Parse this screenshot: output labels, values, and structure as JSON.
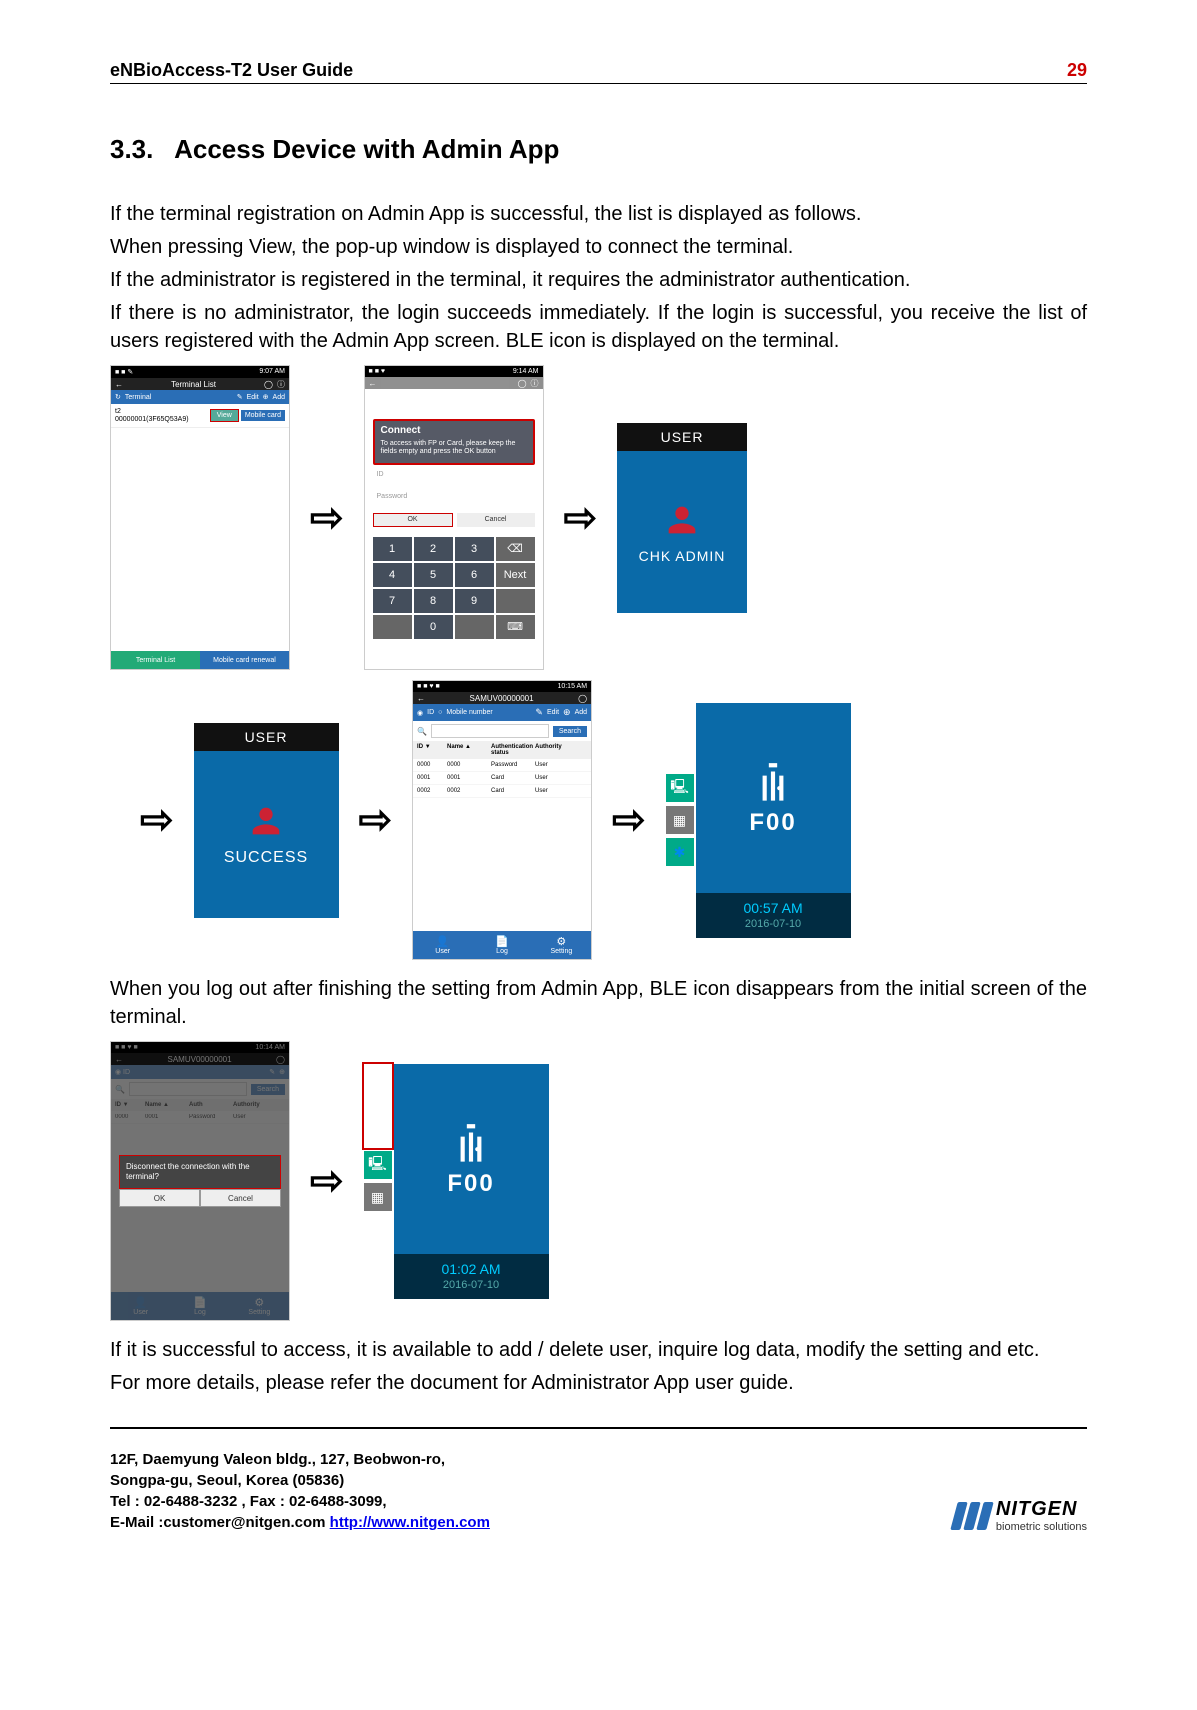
{
  "header": {
    "title": "eNBioAccess-T2 User Guide",
    "page": "29"
  },
  "section": {
    "num": "3.3.",
    "title": "Access Device with Admin App"
  },
  "para1": [
    "If the terminal registration on Admin App is successful, the list is displayed as follows.",
    "When pressing View, the pop-up window is displayed to connect the terminal.",
    "If the administrator is registered in the terminal, it requires the administrator authentication.",
    "If there is no administrator, the login succeeds immediately. If the login is successful, you receive the list of users registered with the Admin App screen. BLE icon is displayed on the terminal."
  ],
  "para2": "When you log out after finishing the setting from Admin App, BLE icon disappears from the initial screen of the terminal.",
  "para3": [
    "If it is successful to access, it is available to add / delete user, inquire log data, modify the setting and etc.",
    "For more details, please refer the document for Administrator App user guide."
  ],
  "phone1": {
    "status_left": "■ ■ ✎",
    "status_right": "9:07 AM",
    "nav_title": "Terminal List",
    "toolbar": {
      "terminal": "Terminal",
      "edit": "Edit",
      "add": "Add"
    },
    "term_name": "t2",
    "term_mac": "00000001(3F65Q53A9)",
    "btn_view": "View",
    "btn_mobile": "Mobile card",
    "tabs": {
      "list": "Terminal List",
      "renew": "Mobile card renewal"
    }
  },
  "phone2": {
    "status_right": "9:14 AM",
    "dlg_title": "Connect",
    "dlg_msg": "To access with FP or Card, please keep the fields empty and press the OK button",
    "id_ph": "ID",
    "pw_ph": "Password",
    "btn_ok": "OK",
    "btn_cancel": "Cancel",
    "keys": [
      "1",
      "2",
      "3",
      "⌫",
      "4",
      "5",
      "6",
      "Next",
      "7",
      "8",
      "9",
      "",
      "",
      "0",
      "",
      "⌨"
    ]
  },
  "mini_chk": {
    "top": "USER",
    "label": "CHK ADMIN"
  },
  "mini_success": {
    "top": "USER",
    "label": "SUCCESS"
  },
  "phone3": {
    "status_right": "10:15 AM",
    "title": "SAMUV00000001",
    "toolbar": {
      "id": "ID",
      "mobile": "Mobile number",
      "edit": "Edit",
      "add": "Add"
    },
    "search_btn": "Search",
    "cols": {
      "c1": "ID ▼",
      "c2": "Name ▲",
      "c3": "Authentication status",
      "c4": "Authority"
    },
    "rows": [
      {
        "id": "0000",
        "name": "0000",
        "auth": "Password",
        "role": "User"
      },
      {
        "id": "0001",
        "name": "0001",
        "auth": "Card",
        "role": "User"
      },
      {
        "id": "0002",
        "name": "0002",
        "auth": "Card",
        "role": "User"
      }
    ],
    "nav": {
      "user": "User",
      "log": "Log",
      "setting": "Setting"
    }
  },
  "mini_f00_a": {
    "big": "F00",
    "time": "00:57 AM",
    "date": "2016-07-10"
  },
  "phone4": {
    "status_right": "10:14 AM",
    "title": "SAMUV00000001",
    "row": {
      "id": "0000",
      "name": "0001",
      "auth": "Password",
      "role": "User"
    },
    "disc_msg": "Disconnect the connection with the terminal?",
    "btn_ok": "OK",
    "btn_cancel": "Cancel"
  },
  "mini_f00_b": {
    "big": "F00",
    "time": "01:02 AM",
    "date": "2016-07-10"
  },
  "footer": {
    "addr1": "12F, Daemyung Valeon bldg., 127, Beobwon-ro,",
    "addr2": "Songpa-gu, Seoul, Korea (05836)",
    "addr3": "Tel : 02-6488-3232 , Fax : 02-6488-3099,",
    "addr4_a": "E-Mail :customer@nitgen.com ",
    "addr4_b": "http://www.nitgen.com",
    "logo": "NITGEN",
    "tag": "biometric solutions"
  }
}
